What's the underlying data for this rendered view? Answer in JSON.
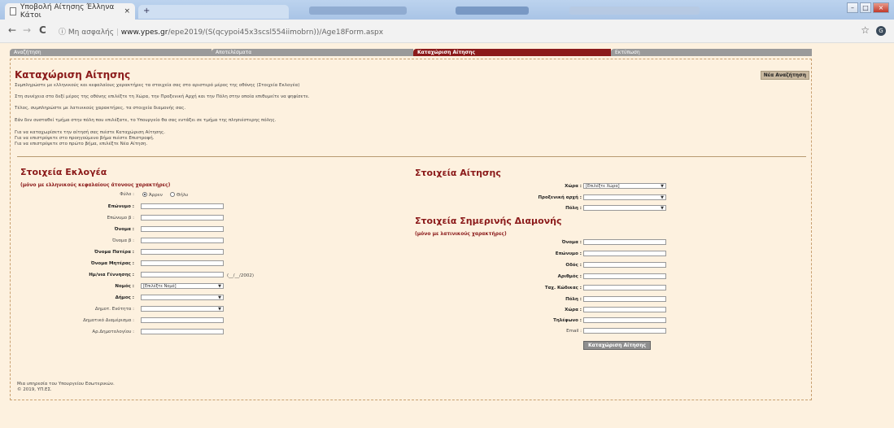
{
  "browser": {
    "tab_title": "Υποβολή Αίτησης Έλληνα Κάτοι",
    "nav_back": "←",
    "nav_forward": "→",
    "nav_reload": "C",
    "security_label": "ⓘ Μη ασφαλής",
    "url_host": "www.ypes.gr",
    "url_path": "/epe2019/(S(qcypoi45x3scsl554iimobrn))/Age18Form.aspx",
    "star": "☆",
    "avatar": "G",
    "close_tab": "×",
    "new_tab": "+"
  },
  "menu": {
    "tabs": [
      {
        "label": "Αναζήτηση"
      },
      {
        "label": "Αποτελέσματα"
      },
      {
        "label": "Καταχώριση Αίτησης"
      },
      {
        "label": "Εκτύπωση"
      }
    ]
  },
  "page": {
    "title": "Καταχώριση Αίτησης",
    "new_search_label": "Νέα Αναζήτηση",
    "instructions": [
      "Συμπληρώστε με ελληνικούς και κεφαλαίους χαρακτήρες τα στοιχεία σας στο αριστερό μέρος της οθόνης (Στοιχεία Εκλογέα)",
      "Στη συνέχεια στο δεξί μέρος της οθόνης επιλέξτε τη Χώρα, την Προξενική Αρχή και την Πόλη στην οποία επιθυμείτε να ψηφίσετε.",
      "Τέλος, συμπληρώστε με λατινικούς χαρακτήρες, τα στοιχεία διαμονής σας.",
      "Εάν δεν συσταθεί τμήμα στην πόλη που επιλέξατε, το Υπουργείο θα σας εντάξει σε τμήμα της πλησιέστερης πόλης.",
      "Για να καταχωρίσετε την αίτησή σας πιέστε Καταχώριση Αίτησης.",
      "Για να επιστρέψετε στο προηγούμενο βήμα πιέστε Επιστροφή.",
      "Για να επιστρέψετε στο πρώτο βήμα, επιλέξτε Νέα Αίτηση."
    ]
  },
  "voter": {
    "title": "Στοιχεία Εκλογέα",
    "subtitle": "(μόνο με ελληνικούς κεφαλαίους άτονους χαρακτήρες)",
    "gender_label": "Φύλο :",
    "gender_male": "Άρρεν",
    "gender_female": "Θήλυ",
    "fields": [
      {
        "label": "Επώνυμο :",
        "bold": true,
        "type": "input",
        "value": ""
      },
      {
        "label": "Επώνυμο β :",
        "bold": false,
        "type": "input",
        "value": ""
      },
      {
        "label": "Όνομα :",
        "bold": true,
        "type": "input",
        "value": ""
      },
      {
        "label": "Όνομα β :",
        "bold": false,
        "type": "input",
        "value": ""
      },
      {
        "label": "Όνομα Πατέρα :",
        "bold": true,
        "type": "input",
        "value": ""
      },
      {
        "label": "Όνομα Μητέρας :",
        "bold": true,
        "type": "input",
        "value": ""
      },
      {
        "label": "Ημ/νια Γέννησης :",
        "bold": true,
        "type": "input",
        "value": ""
      },
      {
        "label": "Νομός :",
        "bold": true,
        "type": "select",
        "value": "[Επιλέξτε Νομό]"
      },
      {
        "label": "Δήμος :",
        "bold": true,
        "type": "select",
        "value": ""
      },
      {
        "label": "Δημοτ. Ενότητα :",
        "bold": false,
        "type": "select",
        "value": ""
      },
      {
        "label": "Δημοτικό Διαμέρισμα :",
        "bold": false,
        "type": "input",
        "value": ""
      },
      {
        "label": "Αρ.Δημοτολογίου :",
        "bold": false,
        "type": "input",
        "value": ""
      }
    ],
    "birth_hint": "(__/__/2002)"
  },
  "application": {
    "title": "Στοιχεία Αίτησης",
    "fields": [
      {
        "label": "Χώρα :",
        "value": "[Επιλέξτε Χώρα]"
      },
      {
        "label": "Προξενική αρχή :",
        "value": ""
      },
      {
        "label": "Πόλη :",
        "value": ""
      }
    ]
  },
  "residence": {
    "title": "Στοιχεία Σημερινής Διαμονής",
    "subtitle": "(μόνο με λατινικούς χαρακτήρες)",
    "fields": [
      {
        "label": "Όνομα :",
        "bold": true
      },
      {
        "label": "Επώνυμο :",
        "bold": true
      },
      {
        "label": "Οδός :",
        "bold": true
      },
      {
        "label": "Αριθμός :",
        "bold": true
      },
      {
        "label": "Ταχ. Κώδικας :",
        "bold": true
      },
      {
        "label": "Πόλη :",
        "bold": true
      },
      {
        "label": "Χώρα :",
        "bold": true
      },
      {
        "label": "Τηλέφωνο :",
        "bold": true
      },
      {
        "label": "Email :",
        "bold": false
      }
    ],
    "submit_label": "Καταχώριση Αίτησης"
  },
  "footer": {
    "line1": "Μια υπηρεσία του Υπουργείου Εσωτερικών.",
    "line2": "© 2019, ΥΠ.ΕΣ."
  },
  "colors": {
    "accent": "#8b1a1a",
    "page_bg": "#fdf1df",
    "tab_inactive": "#9a9a9a"
  }
}
